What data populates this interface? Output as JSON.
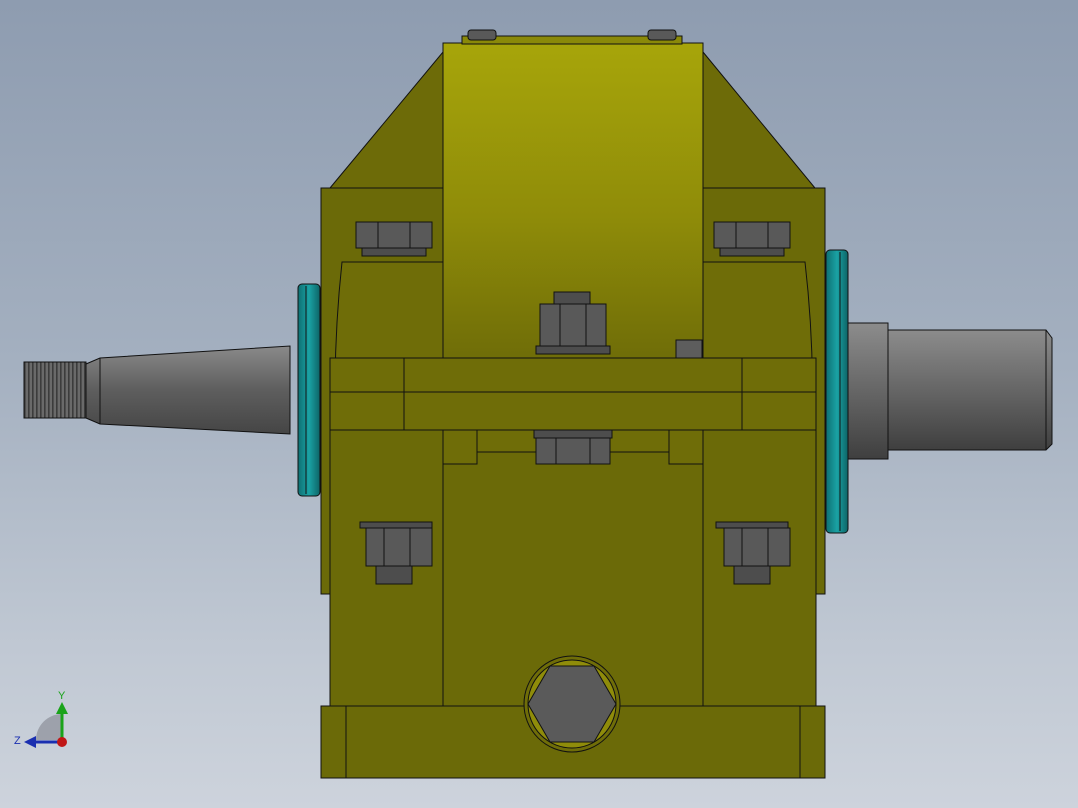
{
  "viewport": {
    "name": "cad-3d-viewport",
    "background_top": "#8e9cb0",
    "background_bottom": "#cdd3dc"
  },
  "model": {
    "name": "gearbox-assembly",
    "colors": {
      "housing_light": "#a9a70a",
      "housing_dark": "#6b6a08",
      "housing_mid": "#8f8c0a",
      "shaft": "#6c6c6c",
      "shaft_dark": "#4a4a4a",
      "seal": "#13898b",
      "bolt": "#555555",
      "edge": "#111111"
    }
  },
  "triad": {
    "y_label": "Y",
    "z_label": "Z",
    "y_color": "#1aa31a",
    "z_color": "#1a2fb0",
    "x_color": "#c01616"
  }
}
